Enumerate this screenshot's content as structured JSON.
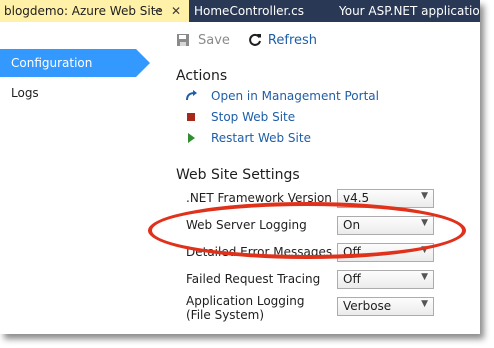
{
  "tabs": [
    {
      "label": "blogdemo: Azure Web Site",
      "active": true
    },
    {
      "label": "HomeController.cs"
    },
    {
      "label": "Your ASP.NET application"
    }
  ],
  "nav": {
    "items": [
      {
        "label": "Configuration",
        "active": true
      },
      {
        "label": "Logs"
      }
    ]
  },
  "toolbar": {
    "save_label": "Save",
    "refresh_label": "Refresh"
  },
  "actions": {
    "title": "Actions",
    "items": [
      {
        "label": "Open in Management Portal",
        "icon": "open-portal-icon"
      },
      {
        "label": "Stop Web Site",
        "icon": "stop-icon"
      },
      {
        "label": "Restart Web Site",
        "icon": "play-icon"
      }
    ]
  },
  "settings": {
    "title": "Web Site Settings",
    "rows": [
      {
        "label": ".NET Framework Version",
        "value": "v4.5"
      },
      {
        "label": "Web Server Logging",
        "value": "On"
      },
      {
        "label": "Detailed Error Messages",
        "value": "Off"
      },
      {
        "label": "Failed Request Tracing",
        "value": "Off"
      },
      {
        "label": "Application Logging\n(File System)",
        "value": "Verbose"
      }
    ]
  },
  "colors": {
    "accent": "#3399ff",
    "tab_active": "#fff1a8",
    "tabstrip": "#293955",
    "link": "#1e5ea8",
    "callout": "#e0311b"
  }
}
